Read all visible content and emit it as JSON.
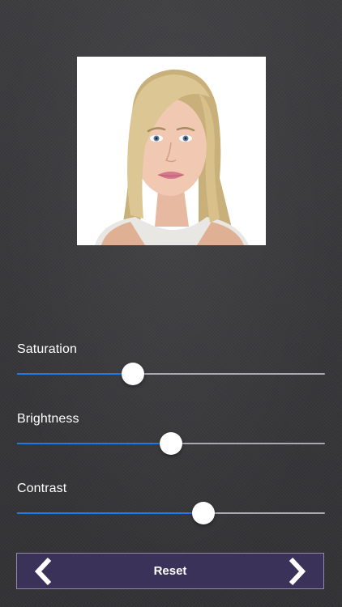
{
  "photo": {
    "alt": "Portrait photo of a smiling blonde woman"
  },
  "sliders": [
    {
      "id": "saturation",
      "label": "Saturation",
      "value": 0.375
    },
    {
      "id": "brightness",
      "label": "Brightness",
      "value": 0.5
    },
    {
      "id": "contrast",
      "label": "Contrast",
      "value": 0.604
    }
  ],
  "colors": {
    "slider_fill": "#1f7ae6",
    "slider_track": "#a9a9ad",
    "reset_bar": "#3a3258",
    "background": "#3b3b3d"
  },
  "footer": {
    "reset_label": "Reset",
    "prev_icon": "chevron-left-icon",
    "next_icon": "chevron-right-icon"
  }
}
